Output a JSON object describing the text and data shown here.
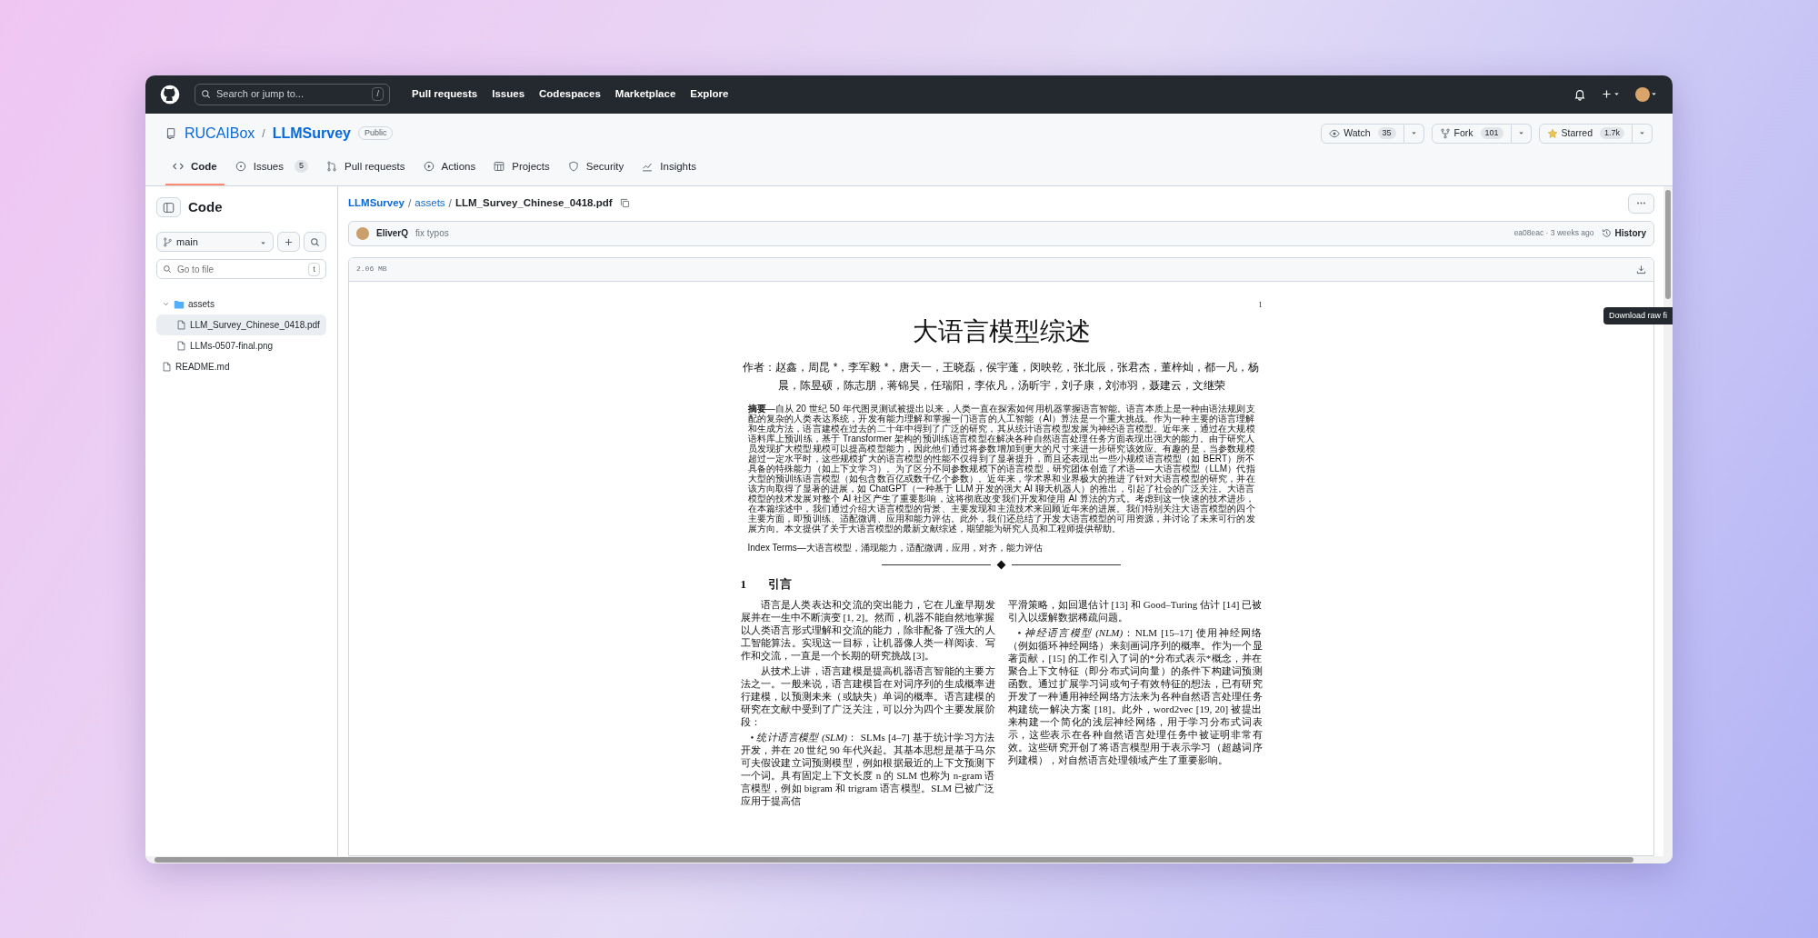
{
  "header": {
    "search_placeholder": "Search or jump to...",
    "search_key": "/",
    "nav": [
      "Pull requests",
      "Issues",
      "Codespaces",
      "Marketplace",
      "Explore"
    ]
  },
  "repo": {
    "owner": "RUCAIBox",
    "separator": "/",
    "name": "LLMSurvey",
    "visibility": "Public",
    "actions": [
      {
        "kind": "watch",
        "label": "Watch",
        "count": "35"
      },
      {
        "kind": "fork",
        "label": "Fork",
        "count": "101"
      },
      {
        "kind": "star",
        "label": "Starred",
        "count": "1.7k"
      }
    ]
  },
  "tabs": [
    {
      "kind": "code",
      "label": "Code",
      "selected": true
    },
    {
      "kind": "issues",
      "label": "Issues",
      "count": "5",
      "selected": false
    },
    {
      "kind": "pulls",
      "label": "Pull requests",
      "selected": false
    },
    {
      "kind": "actions",
      "label": "Actions",
      "selected": false
    },
    {
      "kind": "projects",
      "label": "Projects",
      "selected": false
    },
    {
      "kind": "security",
      "label": "Security",
      "selected": false
    },
    {
      "kind": "insights",
      "label": "Insights",
      "selected": false
    }
  ],
  "sidebar": {
    "title": "Code",
    "branch": "main",
    "filter_placeholder": "Go to file",
    "filter_key": "t",
    "tree": [
      {
        "kind": "folder",
        "name": "assets",
        "expanded": true,
        "selected": false,
        "children": [
          {
            "kind": "file",
            "name": "LLM_Survey_Chinese_0418.pdf",
            "selected": true
          },
          {
            "kind": "file",
            "name": "LLMs-0507-final.png",
            "selected": false
          }
        ]
      },
      {
        "kind": "file",
        "name": "README.md",
        "selected": false
      }
    ]
  },
  "file": {
    "breadcrumb": [
      "LLMSurvey",
      "assets"
    ],
    "separator": "/",
    "filename": "LLM_Survey_Chinese_0418.pdf",
    "commit": {
      "author": "EliverQ",
      "message": "fix typos",
      "meta": "ea08eac · 3 weeks ago",
      "history": "History"
    },
    "size": "2.06 MB",
    "tooltip": "Download raw fi"
  },
  "pdf": {
    "page_number": "1",
    "title": "大语言模型综述",
    "authors": "作者：赵鑫，周昆 *，李军毅 *，唐天一，王晓磊，侯宇蓬，闵映乾，张北辰，张君杰，董梓灿，都一凡，杨晨，陈昱硕，陈志朋，蒋锦昊，任瑞阳，李依凡，汤昕宇，刘子康，刘沛羽，聂建云，文继荣",
    "abstract": "**摘要**—自从 20 世纪 50 年代图灵测试被提出以来，人类一直在探索如何用机器掌握语言智能。语言本质上是一种由语法规则支配的复杂的人类表达系统，开发有能力理解和掌握一门语言的人工智能（AI）算法是一个重大挑战。作为一种主要的语言理解和生成方法，语言建模在过去的二十年中得到了广泛的研究，其从统计语言模型发展为神经语言模型。近年来，通过在大规模语料库上预训练，基于 Transformer 架构的预训练语言模型在解决各种自然语言处理任务方面表现出强大的能力。由于研究人员发现扩大模型规模可以提高模型能力，因此他们通过将参数增加到更大的尺寸来进一步研究该效应。有趣的是，当参数规模超过一定水平时，这些规模扩大的语言模型的性能不仅得到了显著提升，而且还表现出一些小规模语言模型（如 BERT）所不具备的特殊能力（如上下文学习）。为了区分不同参数规模下的语言模型，研究团体创造了术语——大语言模型（LLM）代指大型的预训练语言模型（如包含数百亿或数千亿个参数）。近年来，学术界和业界极大的推进了针对大语言模型的研究，并在该方向取得了显著的进展，如 ChatGPT（一种基于 LLM 开发的强大 AI 聊天机器人）的推出，引起了社会的广泛关注。大语言模型的技术发展对整个 AI 社区产生了重要影响，这将彻底改变我们开发和使用 AI 算法的方式。考虑到这一快速的技术进步，在本篇综述中，我们通过介绍大语言模型的背景、主要发现和主流技术来回顾近年来的进展。我们特别关注大语言模型的四个主要方面，即预训练、适配微调、应用和能力评估。此外，我们还总结了开发大语言模型的可用资源，并讨论了未来可行的发展方向。本文提供了关于大语言模型的最新文献综述，期望能为研究人员和工程师提供帮助。",
    "index_terms": "Index Terms—大语言模型，涌现能力，适配微调，应用，对齐，能力评估",
    "section": {
      "number": "1",
      "title": "引言"
    },
    "left": [
      {
        "kind": "para",
        "text": "语言是人类表达和交流的突出能力，它在儿童早期发展并在一生中不断演变 [1, 2]。然而，机器不能自然地掌握以人类语言形式理解和交流的能力，除非配备了强大的人工智能算法。实现这一目标，让机器像人类一样阅读、写作和交流，一直是一个长期的研究挑战 [3]。"
      },
      {
        "kind": "para",
        "text": "从技术上讲，语言建模是提高机器语言智能的主要方法之一。一般来说，语言建模旨在对词序列的生成概率进行建模，以预测未来（或缺失）单词的概率。语言建模的研究在文献中受到了广泛关注，可以分为四个主要发展阶段："
      },
      {
        "kind": "bullet",
        "text": "• *统计语言模型 (SLM)*： SLMs [4–7] 基于统计学习方法开发，并在 20 世纪 90 年代兴起。其基本思想是基于马尔可夫假设建立词预测模型，例如根据最近的上下文预测下一个词。具有固定上下文长度 n 的 SLM 也称为 n-gram 语言模型，例如 bigram 和 trigram 语言模型。SLM 已被广泛应用于提高信"
      }
    ],
    "right": [
      {
        "kind": "cont",
        "text": "平滑策略，如回退估计 [13] 和 Good–Turing 估计 [14] 已被引入以缓解数据稀疏问题。"
      },
      {
        "kind": "bullet",
        "text": "• *神经语言模型 (NLM)*：NLM [15–17] 使用神经网络（例如循环神经网络）来刻画词序列的概率。作为一个显著贡献，[15] 的工作引入了词的*分布式表示*概念，并在聚合上下文特征（即分布式词向量）的条件下构建词预测函数。通过扩展学习词或句子有效特征的想法，已有研究开发了一种通用神经网络方法来为各种自然语言处理任务构建统一解决方案 [18]。此外，word2vec [19, 20] 被提出来构建一个简化的浅层神经网络，用于学习分布式词表示，这些表示在各种自然语言处理任务中被证明非常有效。这些研究开创了将语言模型用于表示学习（超越词序列建模），对自然语言处理领域产生了重要影响。"
      }
    ]
  }
}
